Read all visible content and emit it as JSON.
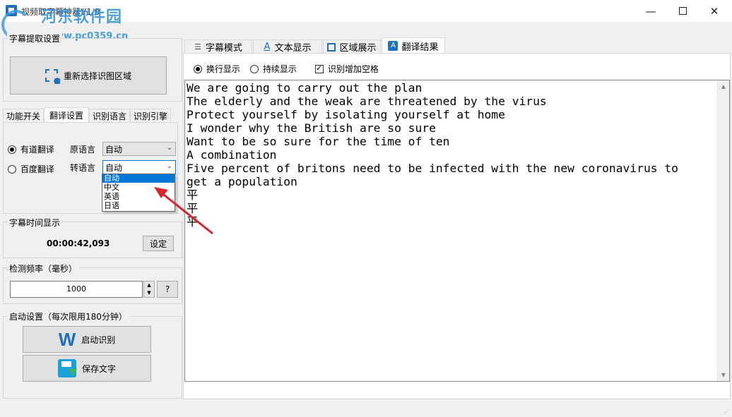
{
  "window": {
    "title": "视频取字幕神器V1.0",
    "watermark_text": "河东软件园",
    "watermark_url": "www.pc0359.cn"
  },
  "left": {
    "group_capture": "字幕提取设置",
    "reselect_button": "重新选择识图区域",
    "tabs": [
      {
        "label": "功能开关"
      },
      {
        "label": "翻译设置",
        "active": true
      },
      {
        "label": "识别语言"
      },
      {
        "label": "识别引擎"
      }
    ],
    "translate": {
      "youdao": "有道翻译",
      "baidu": "百度翻译",
      "source_label": "原语言",
      "source_value": "自动",
      "target_label": "转语言",
      "target_value": "自动",
      "options": [
        "自动",
        "中文",
        "英语",
        "日语"
      ]
    },
    "subtitle_time": {
      "label": "字幕时间显示",
      "value": "00:00:42,093",
      "set_button": "设定"
    },
    "frequency": {
      "label": "检测频率（毫秒）",
      "value": "1000",
      "help_button": "?"
    },
    "start": {
      "label": "启动设置（每次限用180分钟）",
      "start_button": "启动识别",
      "save_button": "保存文字"
    }
  },
  "right": {
    "tabs": [
      {
        "label": "字幕模式",
        "icon": "list-icon"
      },
      {
        "label": "文本显示",
        "icon": "text-icon"
      },
      {
        "label": "区域展示",
        "icon": "region-icon"
      },
      {
        "label": "翻译结果",
        "icon": "translate-icon",
        "active": true
      }
    ],
    "options": {
      "line_break": "换行显示",
      "continuous": "持续显示",
      "add_space": "识别增加空格"
    },
    "result_text": "We are going to carry out the plan\nThe elderly and the weak are threatened by the virus\nProtect yourself by isolating yourself at home\nI wonder why the British are so sure\nWant to be so sure for the time of ten\nA combination\nFive percent of britons need to be infected with the new coronavirus to\nget a population\n平\n平\n平"
  },
  "colors": {
    "selection": "#0078d7",
    "annotation_arrow": "#d9262c"
  }
}
